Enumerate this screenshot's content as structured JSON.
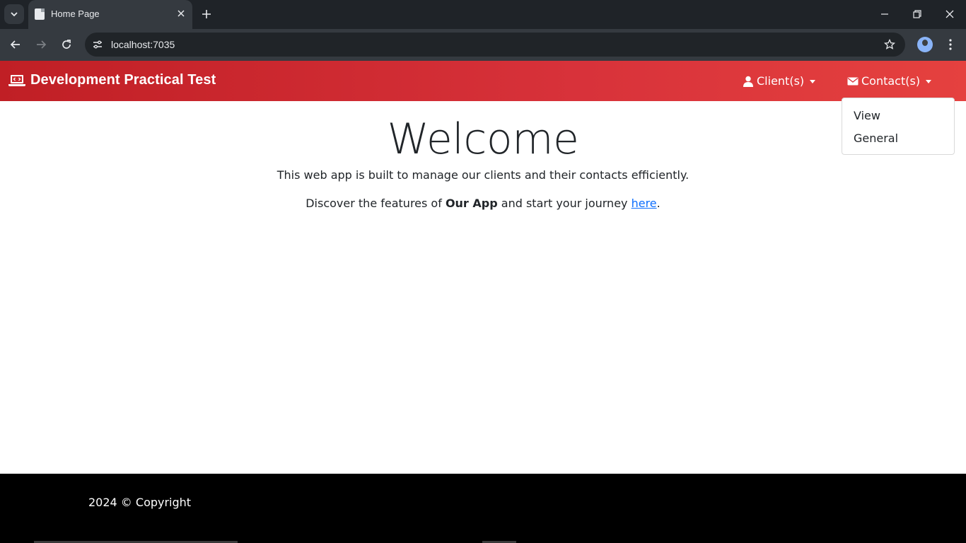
{
  "browser": {
    "tab_title": "Home Page",
    "url": "localhost:7035"
  },
  "navbar": {
    "brand": "Development Practical Test",
    "clients_label": "Client(s)",
    "contacts_label": "Contact(s)",
    "contacts_menu": [
      "View",
      "General"
    ]
  },
  "main": {
    "heading": "Welcome",
    "line1": "This web app is built to manage our clients and their contacts efficiently.",
    "line2_prefix": "Discover the features of ",
    "line2_bold": "Our App",
    "line2_mid": " and start your journey ",
    "line2_link": "here",
    "line2_suffix": "."
  },
  "footer": {
    "copyright": "2024 © Copyright"
  },
  "colors": {
    "navbar_start": "#c01f25",
    "navbar_end": "#e5413f",
    "link": "#0d6efd",
    "footer_bg": "#000000"
  },
  "icons": [
    "tab-list-icon",
    "page-favicon-icon",
    "close-icon",
    "plus-icon",
    "minimize-icon",
    "restore-icon",
    "close-window-icon",
    "back-icon",
    "forward-icon",
    "reload-icon",
    "site-info-icon",
    "star-icon",
    "avatar-icon",
    "more-vert-icon",
    "laptop-code-icon",
    "user-icon",
    "envelope-icon"
  ]
}
